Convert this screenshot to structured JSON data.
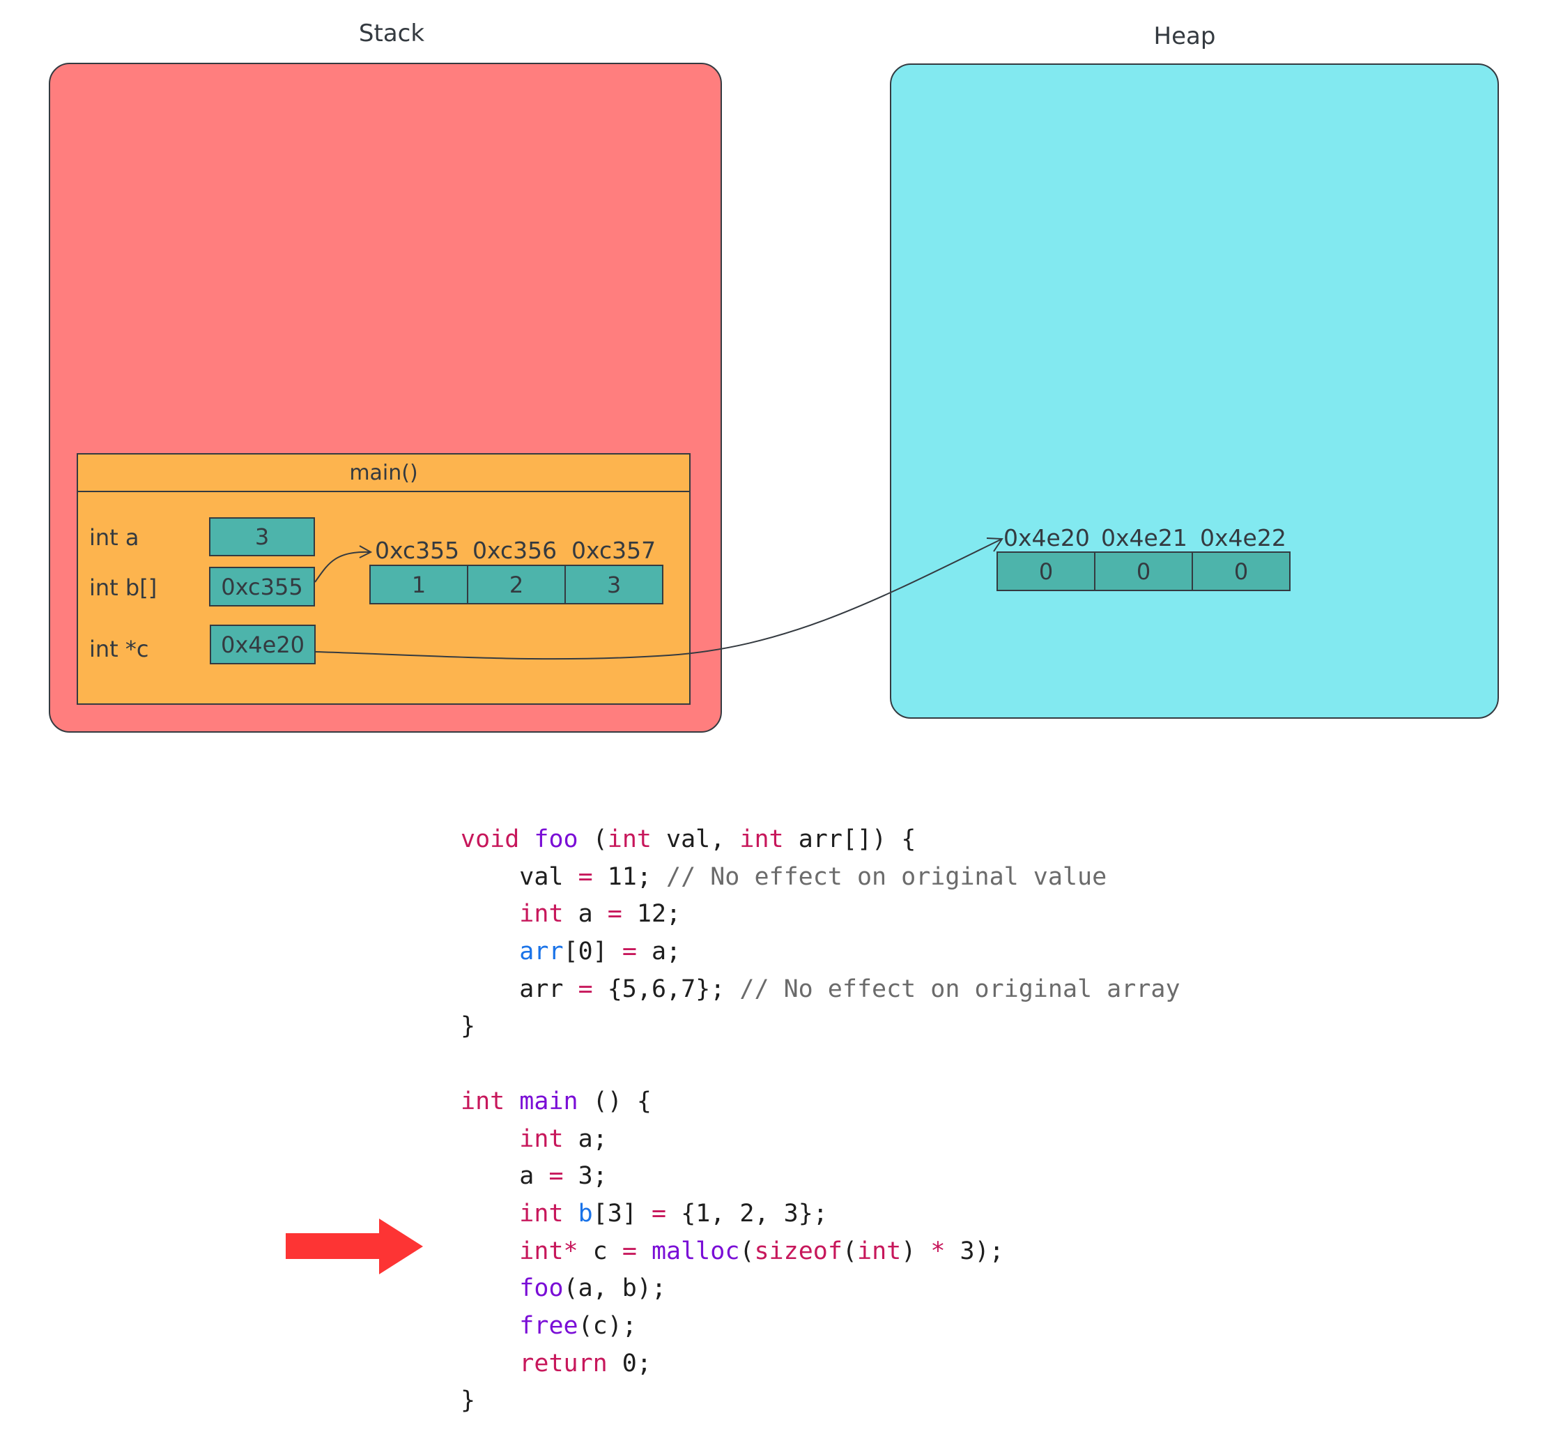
{
  "diagram": {
    "stack_label": "Stack",
    "heap_label": "Heap",
    "colors": {
      "stack_fill": "#ff7e7e",
      "heap_fill": "#82e9f0",
      "frame_fill": "#fdb44e",
      "cell_fill": "#4db4ab",
      "stroke": "#343a40",
      "current_line_arrow": "#fd3434"
    },
    "frame": {
      "title": "main()",
      "variables": [
        {
          "label": "int a",
          "value": "3"
        },
        {
          "label": "int b[]",
          "value": "0xc355"
        },
        {
          "label": "int *c",
          "value": "0x4e20"
        }
      ],
      "array_b": {
        "addresses": [
          "0xc355",
          "0xc356",
          "0xc357"
        ],
        "values": [
          "1",
          "2",
          "3"
        ]
      }
    },
    "heap_array": {
      "addresses": [
        "0x4e20",
        "0x4e21",
        "0x4e22"
      ],
      "values": [
        "0",
        "0",
        "0"
      ]
    },
    "pointers": [
      {
        "from": "int b[]",
        "to": "0xc355"
      },
      {
        "from": "int *c",
        "to": "0x4e20"
      }
    ]
  },
  "code": {
    "current_line_index": 11,
    "lines": [
      [
        {
          "t": "kw",
          "s": "void"
        },
        {
          "t": "tx",
          "s": " "
        },
        {
          "t": "fn",
          "s": "foo"
        },
        {
          "t": "tx",
          "s": " ("
        },
        {
          "t": "kw",
          "s": "int"
        },
        {
          "t": "tx",
          "s": " val, "
        },
        {
          "t": "kw",
          "s": "int"
        },
        {
          "t": "tx",
          "s": " arr[]) {"
        }
      ],
      [
        {
          "t": "tx",
          "s": "    val "
        },
        {
          "t": "op",
          "s": "="
        },
        {
          "t": "tx",
          "s": " 11; "
        },
        {
          "t": "cm",
          "s": "// No effect on original value"
        }
      ],
      [
        {
          "t": "tx",
          "s": "    "
        },
        {
          "t": "kw",
          "s": "int"
        },
        {
          "t": "tx",
          "s": " a "
        },
        {
          "t": "op",
          "s": "="
        },
        {
          "t": "tx",
          "s": " 12;"
        }
      ],
      [
        {
          "t": "tx",
          "s": "    "
        },
        {
          "t": "var",
          "s": "arr"
        },
        {
          "t": "tx",
          "s": "[0] "
        },
        {
          "t": "op",
          "s": "="
        },
        {
          "t": "tx",
          "s": " a;"
        }
      ],
      [
        {
          "t": "tx",
          "s": "    arr "
        },
        {
          "t": "op",
          "s": "="
        },
        {
          "t": "tx",
          "s": " {5,6,7}; "
        },
        {
          "t": "cm",
          "s": "// No effect on original array"
        }
      ],
      [
        {
          "t": "tx",
          "s": "}"
        }
      ],
      [
        {
          "t": "tx",
          "s": ""
        }
      ],
      [
        {
          "t": "kw",
          "s": "int"
        },
        {
          "t": "tx",
          "s": " "
        },
        {
          "t": "fn",
          "s": "main"
        },
        {
          "t": "tx",
          "s": " () {"
        }
      ],
      [
        {
          "t": "tx",
          "s": "    "
        },
        {
          "t": "kw",
          "s": "int"
        },
        {
          "t": "tx",
          "s": " a;"
        }
      ],
      [
        {
          "t": "tx",
          "s": "    a "
        },
        {
          "t": "op",
          "s": "="
        },
        {
          "t": "tx",
          "s": " 3;"
        }
      ],
      [
        {
          "t": "tx",
          "s": "    "
        },
        {
          "t": "kw",
          "s": "int"
        },
        {
          "t": "tx",
          "s": " "
        },
        {
          "t": "var",
          "s": "b"
        },
        {
          "t": "tx",
          "s": "[3] "
        },
        {
          "t": "op",
          "s": "="
        },
        {
          "t": "tx",
          "s": " {1, 2, 3};"
        }
      ],
      [
        {
          "t": "tx",
          "s": "    "
        },
        {
          "t": "kw",
          "s": "int*"
        },
        {
          "t": "tx",
          "s": " c "
        },
        {
          "t": "op",
          "s": "="
        },
        {
          "t": "tx",
          "s": " "
        },
        {
          "t": "fn",
          "s": "malloc"
        },
        {
          "t": "tx",
          "s": "("
        },
        {
          "t": "kw",
          "s": "sizeof"
        },
        {
          "t": "tx",
          "s": "("
        },
        {
          "t": "kw",
          "s": "int"
        },
        {
          "t": "tx",
          "s": ") "
        },
        {
          "t": "op",
          "s": "*"
        },
        {
          "t": "tx",
          "s": " 3);"
        }
      ],
      [
        {
          "t": "tx",
          "s": "    "
        },
        {
          "t": "fn",
          "s": "foo"
        },
        {
          "t": "tx",
          "s": "(a, b);"
        }
      ],
      [
        {
          "t": "tx",
          "s": "    "
        },
        {
          "t": "fn",
          "s": "free"
        },
        {
          "t": "tx",
          "s": "(c);"
        }
      ],
      [
        {
          "t": "tx",
          "s": "    "
        },
        {
          "t": "kw",
          "s": "return"
        },
        {
          "t": "tx",
          "s": " 0;"
        }
      ],
      [
        {
          "t": "tx",
          "s": "}"
        }
      ]
    ]
  }
}
